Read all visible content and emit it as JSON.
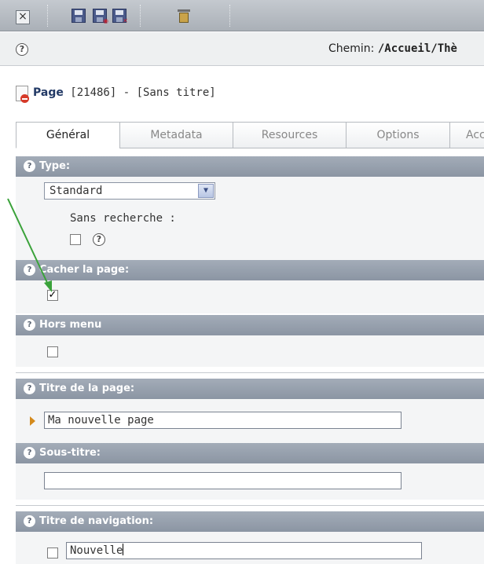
{
  "toolbar": {
    "close_icon": "close-icon",
    "icons": [
      "save-icon",
      "save-view-icon",
      "save-close-icon",
      "delete-icon"
    ]
  },
  "pathbar": {
    "help_glyph": "?",
    "label": "Chemin: ",
    "value": "/Accueil/Thè"
  },
  "record": {
    "type_label": "Page",
    "title_rest": " [21486] - [Sans titre]"
  },
  "tabs": [
    {
      "label": "Général"
    },
    {
      "label": "Metadata"
    },
    {
      "label": "Resources"
    },
    {
      "label": "Options"
    },
    {
      "label": "Acc"
    }
  ],
  "sections": {
    "type": {
      "label": "Type:",
      "select_value": "Standard",
      "sub_label": "Sans recherche :",
      "sub_checked": false
    },
    "hide": {
      "label": "Cacher la page:",
      "checked": true
    },
    "nav_hide": {
      "label": "Hors menu",
      "checked": false
    },
    "title": {
      "label": "Titre de la page:",
      "value": "Ma nouvelle page"
    },
    "subtitle": {
      "label": "Sous-titre:",
      "value": ""
    },
    "nav_title": {
      "label": "Titre de navigation:",
      "value": "Nouvelle",
      "checked": false
    }
  },
  "colors": {
    "section_header": "#8b95a3",
    "annotation_arrow": "#3aa23a",
    "link_blue": "#233a66"
  }
}
